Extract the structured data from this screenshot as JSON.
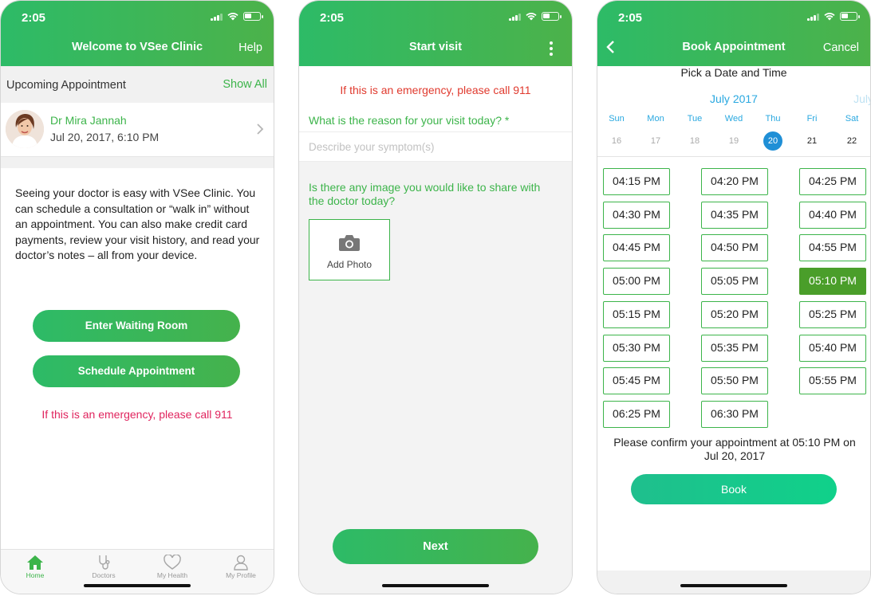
{
  "status": {
    "time": "2:05"
  },
  "screen1": {
    "header": {
      "title": "Welcome to VSee Clinic",
      "right": "Help"
    },
    "upcoming": {
      "label": "Upcoming Appointment",
      "show_all": "Show All"
    },
    "appointment": {
      "doctor": "Dr Mira Jannah",
      "datetime": "Jul 20, 2017, 6:10 PM"
    },
    "intro": "Seeing your doctor is easy with VSee Clinic. You can schedule a consultation or “walk in” without an appointment. You can also make credit card payments, review your visit history, and read your doctor’s notes – all from your device.",
    "buttons": {
      "waiting_room": "Enter Waiting Room",
      "schedule": "Schedule Appointment"
    },
    "emergency": "If this is an emergency, please call 911",
    "tabs": [
      {
        "label": "Home",
        "icon": "home-icon"
      },
      {
        "label": "Doctors",
        "icon": "stethoscope-icon"
      },
      {
        "label": "My Health",
        "icon": "heart-icon"
      },
      {
        "label": "My Profile",
        "icon": "person-icon"
      }
    ]
  },
  "screen2": {
    "header": {
      "title": "Start visit"
    },
    "emergency": "If this is an emergency, please call 911",
    "reason_question": "What is the reason for your visit today? *",
    "symptom_placeholder": "Describe your symptom(s)",
    "image_question": "Is there any image you would like to share with the doctor today?",
    "add_photo": "Add Photo",
    "next": "Next"
  },
  "screen3": {
    "header": {
      "title": "Book Appointment",
      "right": "Cancel"
    },
    "pick_title": "Pick a Date and Time",
    "month": "July 2017",
    "next_month": "July",
    "week": [
      {
        "name": "Sun",
        "date": "16"
      },
      {
        "name": "Mon",
        "date": "17"
      },
      {
        "name": "Tue",
        "date": "18"
      },
      {
        "name": "Wed",
        "date": "19"
      },
      {
        "name": "Thu",
        "date": "20"
      },
      {
        "name": "Fri",
        "date": "21"
      },
      {
        "name": "Sat",
        "date": "22"
      }
    ],
    "selected_date": "20",
    "slots": [
      "04:15 PM",
      "04:20 PM",
      "04:25 PM",
      "04:30 PM",
      "04:35 PM",
      "04:40 PM",
      "04:45 PM",
      "04:50 PM",
      "04:55 PM",
      "05:00 PM",
      "05:05 PM",
      "05:10 PM",
      "05:15 PM",
      "05:20 PM",
      "05:25 PM",
      "05:30 PM",
      "05:35 PM",
      "05:40 PM",
      "05:45 PM",
      "05:50 PM",
      "05:55 PM",
      "06:25 PM",
      "06:30 PM"
    ],
    "selected_slot": "05:10 PM",
    "confirm": "Please confirm your appointment at 05:10 PM on Jul 20, 2017",
    "book": "Book"
  },
  "colors": {
    "brand_green": "#3cb44a",
    "emergency_red": "#e0245e",
    "calendar_blue": "#29a8e0",
    "selected_slot": "#4a9e2a"
  }
}
